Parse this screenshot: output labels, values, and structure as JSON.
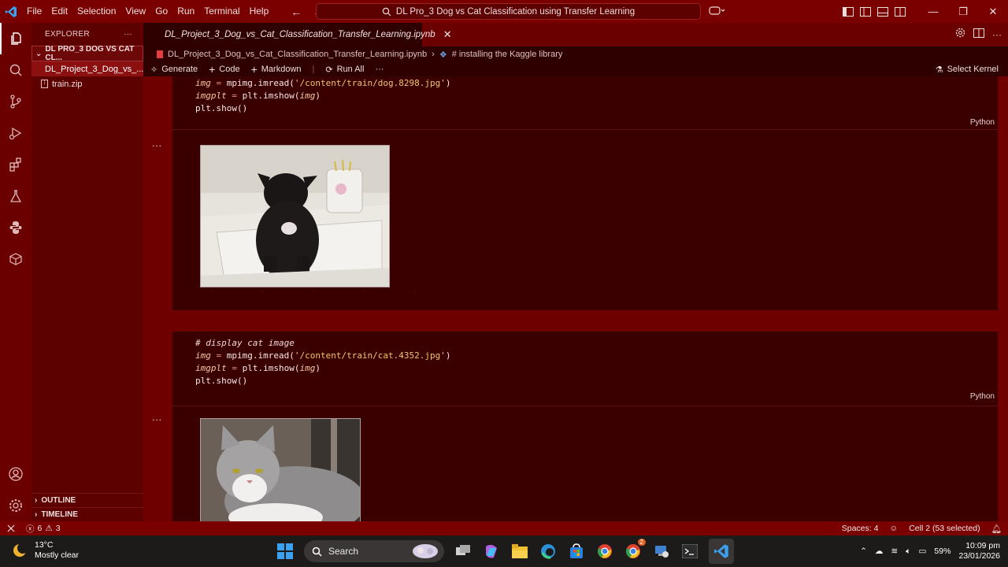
{
  "titlebar": {
    "menu": [
      "File",
      "Edit",
      "Selection",
      "View",
      "Go",
      "Run",
      "Terminal",
      "Help"
    ],
    "command_center": "DL Pro_3 Dog vs Cat Classification using Transfer Learning"
  },
  "sidebar": {
    "header": "EXPLORER",
    "folder": "DL PRO_3 DOG VS CAT CL...",
    "files": [
      "DL_Project_3_Dog_vs_...",
      "train.zip"
    ],
    "outline": "OUTLINE",
    "timeline": "TIMELINE"
  },
  "editor": {
    "tab_label": "DL_Project_3_Dog_vs_Cat_Classification_Transfer_Learning.ipynb",
    "breadcrumb_file": "DL_Project_3_Dog_vs_Cat_Classification_Transfer_Learning.ipynb",
    "breadcrumb_cell": "# installing the Kaggle library",
    "toolbar": {
      "generate": "Generate",
      "code": "Code",
      "markdown": "Markdown",
      "run_all": "Run All",
      "select_kernel": "Select Kernel"
    },
    "cell1": {
      "var1": "img",
      "func1": "mpimg.imread(",
      "path1": "'/content/train/dog.8298.jpg'",
      "var2": "imgplt",
      "func2": "plt.imshow(",
      "arg2": "img",
      "line3": "plt.show()",
      "lang": "Python",
      "dots": "..."
    },
    "cell2": {
      "comment": "# display cat image",
      "var1": "img",
      "func1": "mpimg.imread(",
      "path1": "'/content/train/cat.4352.jpg'",
      "var2": "imgplt",
      "func2": "plt.imshow(",
      "arg2": "img",
      "line4": "plt.show()",
      "lang": "Python",
      "dots": "..."
    }
  },
  "statusbar": {
    "errors": "6",
    "warnings": "3",
    "spaces": "Spaces: 4",
    "cell_info": "Cell 2 (53 selected)"
  },
  "taskbar": {
    "temp": "13°C",
    "weather": "Mostly clear",
    "search": "Search",
    "battery": "59%",
    "time": "10:09 pm",
    "date": "23/01/2026",
    "chrome_badge": "2"
  },
  "colors": {
    "titlebar": "#7a0000",
    "editor_bg": "#2e0000",
    "cell_bg": "#3a0000",
    "accent": "#6e0000"
  }
}
